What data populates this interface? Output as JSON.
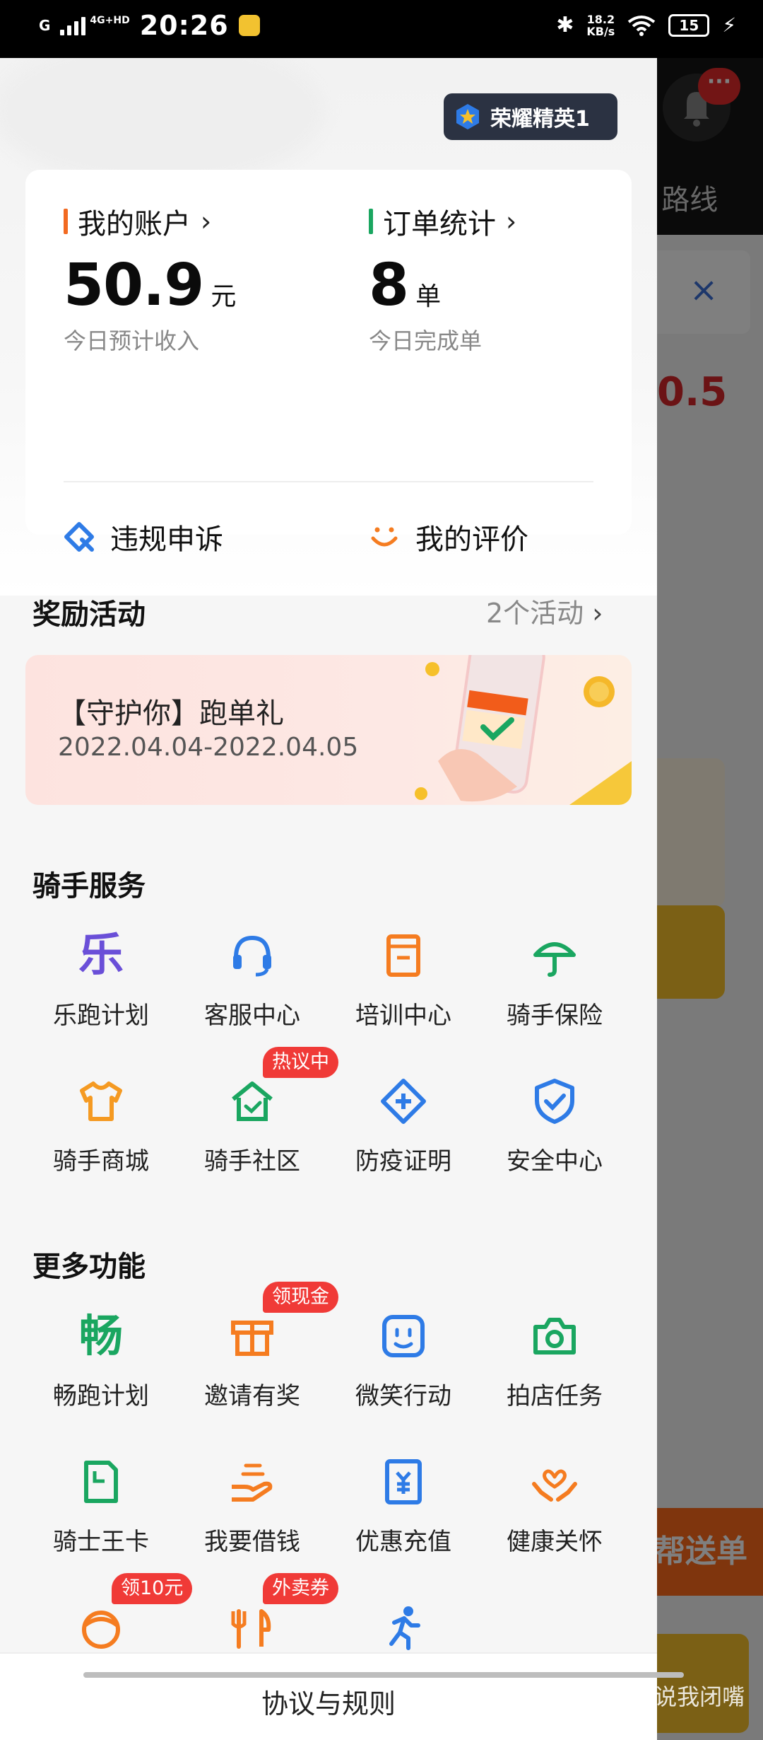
{
  "status_bar": {
    "network": "G",
    "network_type": "4G+HD",
    "time": "20:26",
    "speed_value": "18.2",
    "speed_unit": "KB/s",
    "battery": "15"
  },
  "drawer": {
    "level_badge": "荣耀精英1",
    "account": {
      "title": "我的账户",
      "value": "50.9",
      "unit": "元",
      "subtitle": "今日预计收入",
      "accent_color": "#f26a21"
    },
    "orders": {
      "title": "订单统计",
      "value": "8",
      "unit": "单",
      "subtitle": "今日完成单",
      "accent_color": "#1aa660"
    },
    "links": {
      "appeal": "违规申诉",
      "my_review": "我的评价"
    },
    "rewards": {
      "title": "奖励活动",
      "count_label": "2个活动",
      "banner_title": "【守护你】跑单礼",
      "banner_date": "2022.04.04-2022.04.05"
    },
    "rider_services": {
      "title": "骑手服务",
      "items": [
        {
          "label": "乐跑计划",
          "icon": "le-run-icon",
          "color": "#6a4fd8"
        },
        {
          "label": "客服中心",
          "icon": "headset-icon",
          "color": "#2e7be6"
        },
        {
          "label": "培训中心",
          "icon": "training-book-icon",
          "color": "#f57c20"
        },
        {
          "label": "骑手保险",
          "icon": "umbrella-icon",
          "color": "#1aa660"
        },
        {
          "label": "骑手商城",
          "icon": "tshirt-icon",
          "color": "#f59a22",
          "tag": ""
        },
        {
          "label": "骑手社区",
          "icon": "community-house-icon",
          "color": "#1aa660",
          "tag": "热议中"
        },
        {
          "label": "防疫证明",
          "icon": "medical-diamond-icon",
          "color": "#2e7be6"
        },
        {
          "label": "安全中心",
          "icon": "shield-check-icon",
          "color": "#2e7be6"
        }
      ]
    },
    "more_features": {
      "title": "更多功能",
      "items": [
        {
          "label": "畅跑计划",
          "icon": "chang-run-icon",
          "color": "#1aa660",
          "glyph": "畅"
        },
        {
          "label": "邀请有奖",
          "icon": "gift-box-icon",
          "color": "#f57c20",
          "tag": "领现金"
        },
        {
          "label": "微笑行动",
          "icon": "smile-face-icon",
          "color": "#2e7be6"
        },
        {
          "label": "拍店任务",
          "icon": "camera-icon",
          "color": "#1aa660"
        },
        {
          "label": "骑士王卡",
          "icon": "sim-card-icon",
          "color": "#1aa660"
        },
        {
          "label": "我要借钱",
          "icon": "hand-money-icon",
          "color": "#f57c20"
        },
        {
          "label": "优惠充值",
          "icon": "recharge-card-icon",
          "color": "#2e7be6"
        },
        {
          "label": "健康关怀",
          "icon": "heart-hands-icon",
          "color": "#f57c20"
        },
        {
          "label": "",
          "icon": "rider-face-icon",
          "color": "#f57c20",
          "tag": "领10元"
        },
        {
          "label": "",
          "icon": "fork-knife-icon",
          "color": "#f57c20",
          "tag": "外卖券"
        },
        {
          "label": "",
          "icon": "running-person-icon",
          "color": "#2e7be6"
        }
      ]
    },
    "footer": "协议与规则"
  },
  "background": {
    "route_label": "路线",
    "amount_fragment": "0.5",
    "orange_button": "帮送单",
    "bell_badge": "···"
  },
  "watermark": "知乎 @我不说我闭嘴"
}
